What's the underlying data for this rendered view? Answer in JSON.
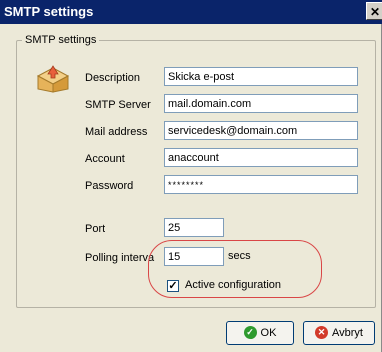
{
  "window": {
    "title": "SMTP settings",
    "close_glyph": "✕"
  },
  "group": {
    "legend": "SMTP settings"
  },
  "fields": {
    "description": {
      "label": "Description",
      "value": "Skicka e-post"
    },
    "smtp_server": {
      "label": "SMTP Server",
      "value": "mail.domain.com"
    },
    "mail_address": {
      "label": "Mail address",
      "value": "servicedesk@domain.com"
    },
    "account": {
      "label": "Account",
      "value": "anaccount"
    },
    "password": {
      "label": "Password",
      "value": "********"
    },
    "port": {
      "label": "Port",
      "value": "25"
    },
    "polling": {
      "label": "Polling interva",
      "value": "15",
      "unit": "secs"
    }
  },
  "active": {
    "label": "Active configuration",
    "checked": true,
    "check_glyph": "✓"
  },
  "buttons": {
    "ok": {
      "label": "OK",
      "icon": "check-circle-icon",
      "icon_glyph": "✓",
      "icon_color": "#2e9a2e"
    },
    "cancel": {
      "label": "Avbryt",
      "icon": "cancel-circle-icon",
      "icon_glyph": "✕",
      "icon_color": "#d23a2a"
    }
  },
  "colors": {
    "title_bar": "#0a246a",
    "highlight_circle": "#d94646",
    "dialog_bg": "#ece9d8"
  }
}
